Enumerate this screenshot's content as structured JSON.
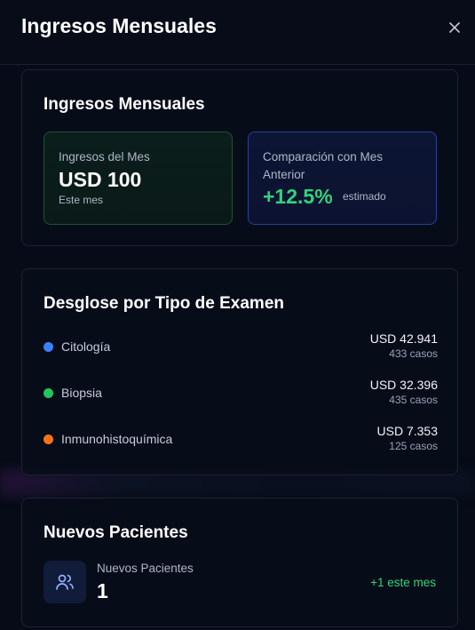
{
  "header": {
    "title": "Ingresos Mensuales"
  },
  "monthly_income": {
    "title": "Ingresos Mensuales",
    "month_income": {
      "label": "Ingresos del Mes",
      "value": "USD 100",
      "sub": "Este mes"
    },
    "comparison": {
      "label": "Comparación con Mes Anterior",
      "value": "+12.5%",
      "sub": "estimado"
    }
  },
  "breakdown": {
    "title": "Desglose por Tipo de Examen",
    "items": [
      {
        "name": "Citología",
        "amount": "USD 42.941",
        "cases": "433 casos",
        "color": "#3b82f6"
      },
      {
        "name": "Biopsia",
        "amount": "USD 32.396",
        "cases": "435 casos",
        "color": "#22c55e"
      },
      {
        "name": "Inmunohistoquímica",
        "amount": "USD 7.353",
        "cases": "125 casos",
        "color": "#f97316"
      }
    ]
  },
  "new_patients": {
    "title": "Nuevos Pacientes",
    "label": "Nuevos Pacientes",
    "value": "1",
    "delta": "+1 este mes"
  },
  "colors": {
    "accent_green": "#34d27a",
    "accent_blue": "#3b5bdb",
    "background": "#060b17"
  },
  "icons": {
    "close": "close-icon",
    "patients": "users-icon"
  }
}
